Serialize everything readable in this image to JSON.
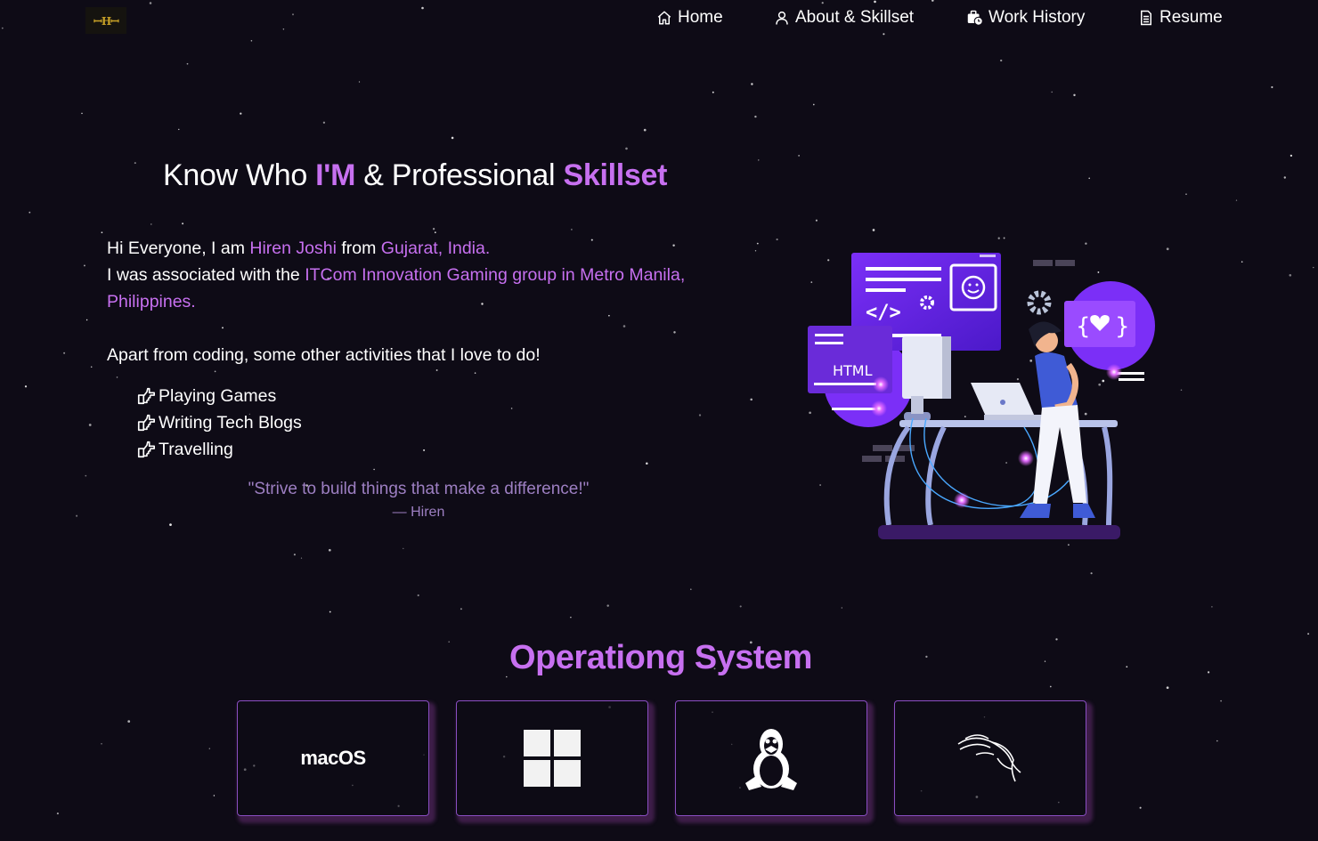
{
  "navbar": {
    "logo_text": "H",
    "items": [
      {
        "label": "Home",
        "icon": "home-icon"
      },
      {
        "label": "About & Skillset",
        "icon": "user-icon"
      },
      {
        "label": "Work History",
        "icon": "briefcase-clock-icon"
      },
      {
        "label": "Resume",
        "icon": "document-icon"
      }
    ]
  },
  "about": {
    "heading": {
      "part1": "Know Who ",
      "highlight1": "I'M",
      "part2": " & Professional ",
      "highlight2": "Skillset"
    },
    "intro": {
      "line1_prefix": "Hi Everyone, I am ",
      "name": "Hiren Joshi",
      "line1_mid": " from ",
      "location": "Gujarat, India.",
      "line2_prefix": "I was associated with the ",
      "company": "ITCom Innovation Gaming group in Metro Manila, Philippines.",
      "hobbies_intro": "Apart from coding, some other activities that I love to do!"
    },
    "activities": [
      "Playing Games",
      "Writing Tech Blogs",
      "Travelling"
    ],
    "quote": {
      "text": "\"Strive to build things that make a difference!\"",
      "author": "— Hiren"
    },
    "illustration": {
      "html_label": "HTML"
    }
  },
  "os_section": {
    "title": "Operationg System",
    "cards": [
      {
        "label": "macOS",
        "icon": "macos-logo"
      },
      {
        "label": "",
        "icon": "windows-logo-icon"
      },
      {
        "label": "",
        "icon": "linux-tux-icon"
      },
      {
        "label": "",
        "icon": "kali-linux-dragon-icon"
      }
    ]
  },
  "colors": {
    "background": "#0e0b16",
    "accent": "#c770f0",
    "quote": "#9d7fc2",
    "card_border": "#8a4ec2"
  }
}
